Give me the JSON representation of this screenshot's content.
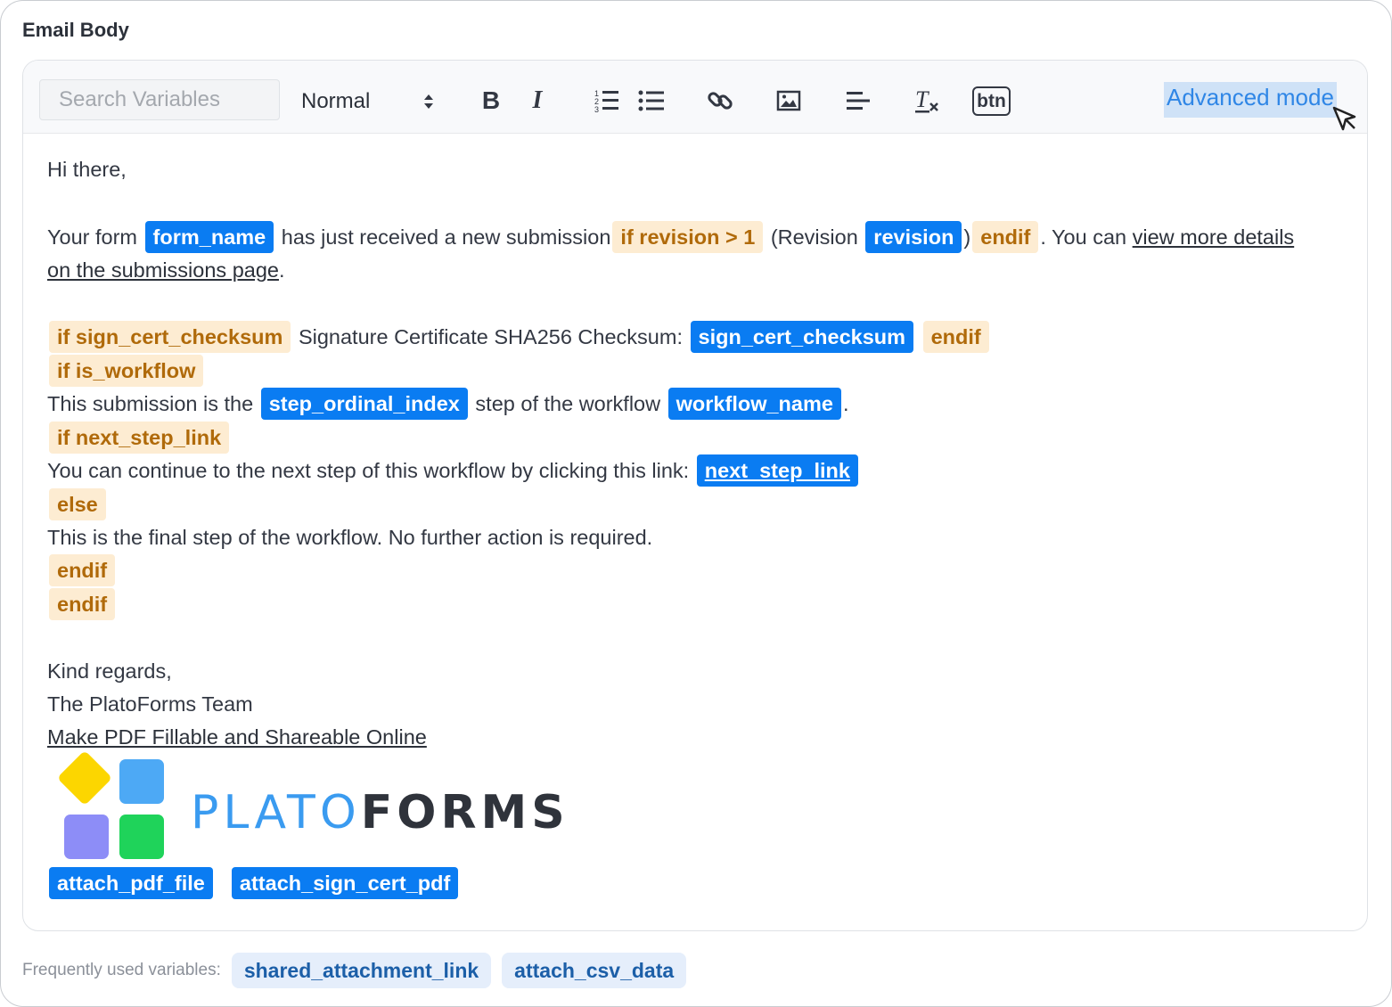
{
  "section_title": "Email Body",
  "toolbar": {
    "search_placeholder": "Search Variables",
    "heading_value": "Normal",
    "bold_label": "B",
    "italic_label": "I",
    "button_label": "btn",
    "advanced_mode_label": "Advanced mode"
  },
  "body": {
    "greeting": "Hi there,",
    "l2_a": "Your form",
    "v_form_name": "form_name",
    "l2_b": "has just received a new submission",
    "c_if_revision": "if revision > 1",
    "l2_c": "(Revision",
    "v_revision": "revision",
    "l2_d": ")",
    "c_endif_1": "endif",
    "l2_e": ". You can",
    "link_details_1": "view more details ",
    "link_details_2": "on the submissions page",
    "l3_end": ".",
    "c_if_sign": "if sign_cert_checksum",
    "l4_a": "Signature Certificate SHA256 Checksum:",
    "v_sign_cert_checksum": "sign_cert_checksum",
    "c_endif_2": "endif",
    "c_if_workflow": "if is_workflow",
    "l6_a": "This submission is the",
    "v_step_ordinal_index": "step_ordinal_index",
    "l6_b": "step of the workflow",
    "v_workflow_name": "workflow_name",
    "l6_c": ".",
    "c_if_next": "if next_step_link",
    "l8_a": "You can continue to the next step of this workflow by clicking this link:",
    "v_next_step_link": "next_step_link",
    "c_else": "else",
    "l10": "This is the final step of the workflow. No further action is required.",
    "c_endif_3": "endif",
    "c_endif_4": "endif",
    "regards": "Kind regards,",
    "team": "The PlatoForms Team",
    "link_make_pdf": "Make PDF Fillable and Shareable Online",
    "logo_text_a": "PLATO",
    "logo_text_b": "FORMS",
    "v_attach_pdf_file": "attach_pdf_file",
    "v_attach_sign_cert_pdf": "attach_sign_cert_pdf"
  },
  "frequent": {
    "label": "Frequently used variables:",
    "chips": [
      "shared_attachment_link",
      "attach_csv_data"
    ]
  },
  "colors": {
    "variable_bg": "#0a7cf2",
    "condition_bg": "#fdecd2",
    "condition_text": "#b06a0a",
    "link": "#2f86e6",
    "logo_blue": "#3a9bf0",
    "logo_dark": "#2f333b",
    "logo_yellow": "#fcd600",
    "logo_lightblue": "#4da9f5",
    "logo_purple": "#8d8df7",
    "logo_green": "#1fd35a"
  }
}
